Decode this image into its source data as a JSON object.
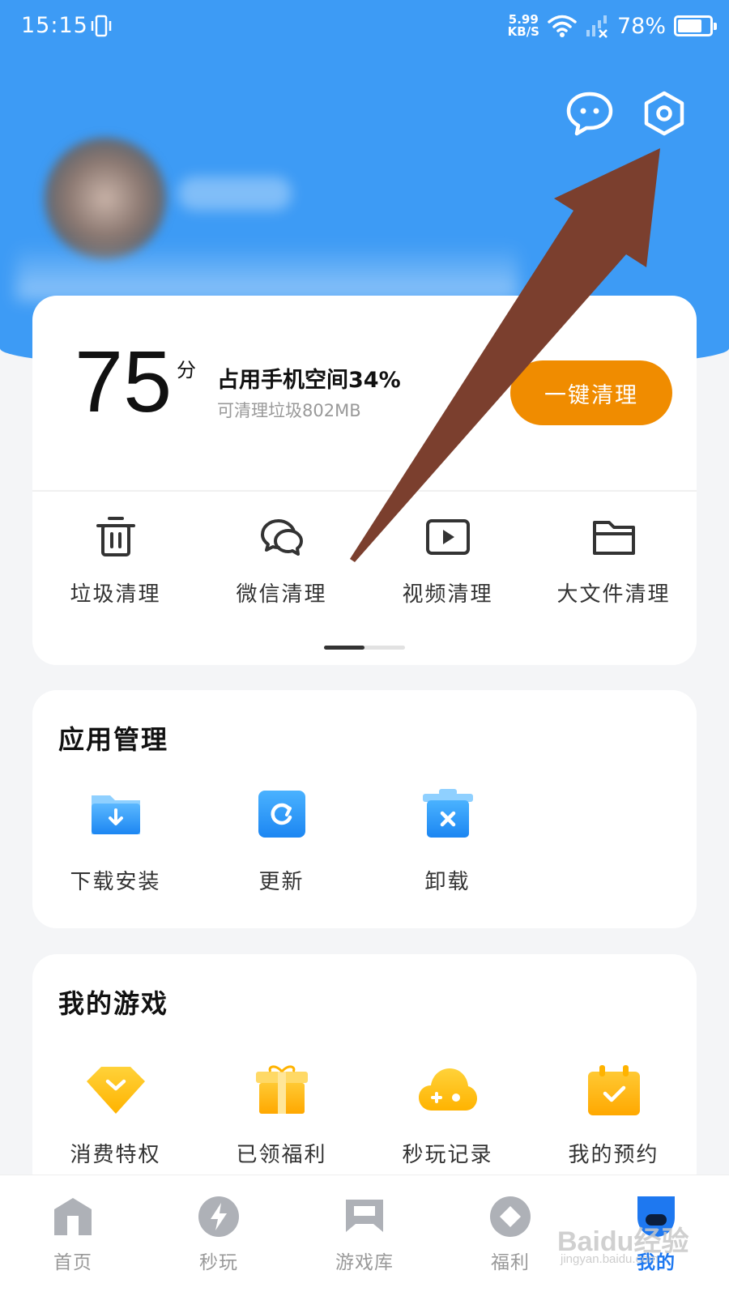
{
  "status_bar": {
    "time": "15:15",
    "net_speed_value": "5.99",
    "net_speed_unit": "KB/S",
    "battery_percent": "78%",
    "battery_level": 0.78
  },
  "header": {
    "message_icon": "message-bubble-icon",
    "settings_icon": "settings-hexagon-icon"
  },
  "clean_card": {
    "score": "75",
    "score_unit": "分",
    "storage_title": "占用手机空间34%",
    "storage_sub": "可清理垃圾802MB",
    "clean_button": "一键清理",
    "tools": [
      {
        "label": "垃圾清理",
        "icon": "trash-icon"
      },
      {
        "label": "微信清理",
        "icon": "wechat-icon"
      },
      {
        "label": "视频清理",
        "icon": "video-icon"
      },
      {
        "label": "大文件清理",
        "icon": "folder-icon"
      }
    ],
    "page_indicator": {
      "pages": 2,
      "active": 1
    }
  },
  "app_management": {
    "title": "应用管理",
    "items": [
      {
        "label": "下载安装",
        "icon": "download-folder-icon"
      },
      {
        "label": "更新",
        "icon": "update-icon"
      },
      {
        "label": "卸载",
        "icon": "uninstall-icon"
      }
    ]
  },
  "my_games": {
    "title": "我的游戏",
    "items": [
      {
        "label": "消费特权",
        "icon": "diamond-icon"
      },
      {
        "label": "已领福利",
        "icon": "gift-box-icon"
      },
      {
        "label": "秒玩记录",
        "icon": "cloud-gamepad-icon"
      },
      {
        "label": "我的预约",
        "icon": "calendar-check-icon"
      }
    ]
  },
  "bottom_nav": [
    {
      "label": "首页",
      "icon": "home-icon",
      "active": false
    },
    {
      "label": "秒玩",
      "icon": "lightning-icon",
      "active": false
    },
    {
      "label": "游戏库",
      "icon": "game-library-icon",
      "active": false
    },
    {
      "label": "福利",
      "icon": "welfare-diamond-icon",
      "active": false
    },
    {
      "label": "我的",
      "icon": "profile-icon",
      "active": true
    }
  ],
  "watermark": {
    "text": "Baidu经验",
    "sub": "jingyan.baidu.com"
  },
  "colors": {
    "header_blue": "#3d9bf5",
    "clean_button_orange": "#f08c00",
    "active_nav_blue": "#1e78f0",
    "annotation_arrow": "#7b3f2e"
  }
}
